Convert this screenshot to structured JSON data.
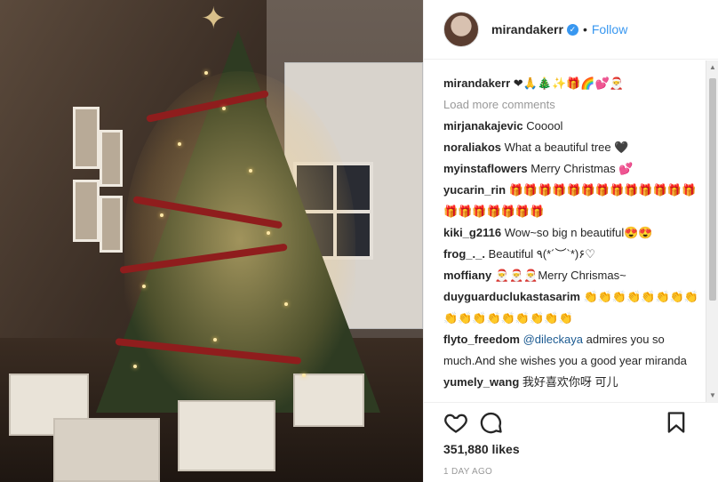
{
  "post": {
    "username": "mirandakerr",
    "follow_label": "Follow",
    "caption_emoji": "❤🙏🎄✨🎁🌈💕🎅",
    "load_more": "Load more comments",
    "likes": "351,880 likes",
    "time": "1 DAY AGO"
  },
  "comments": [
    {
      "user": "mirjanakajevic",
      "text": "Cooool"
    },
    {
      "user": "noraliakos",
      "text": "What a beautiful tree 🖤"
    },
    {
      "user": "myinstaflowers",
      "text": "Merry Christmas 💕"
    },
    {
      "user": "yucarin_rin",
      "text": "🎁🎁🎁🎁🎁🎁🎁🎁🎁🎁🎁🎁🎁🎁🎁🎁🎁🎁🎁🎁"
    },
    {
      "user": "kiki_g2116",
      "text": "Wow~so big n beautiful😍😍"
    },
    {
      "user": "frog_._.",
      "text": "Beautiful ٩(*´︶`*)۶♡"
    },
    {
      "user": "moffiany",
      "text": "🎅🎅🎅Merry Chrismas~"
    },
    {
      "user": "duyguarduclukastasarim",
      "text": "👏👏👏👏👏👏👏👏👏👏👏👏👏👏👏👏👏"
    },
    {
      "user": "flyto_freedom",
      "mention": "@dileckaya",
      "text": "admires you so much.And she wishes you a good year miranda"
    },
    {
      "user": "yumely_wang",
      "text": "我好喜欢你呀 可儿"
    }
  ],
  "icons": {
    "like": "heart-icon",
    "comment": "comment-icon",
    "save": "bookmark-icon",
    "verified": "verified-badge-icon"
  },
  "colors": {
    "link": "#3897f0",
    "mention": "#1b5a91",
    "muted": "#999999"
  }
}
